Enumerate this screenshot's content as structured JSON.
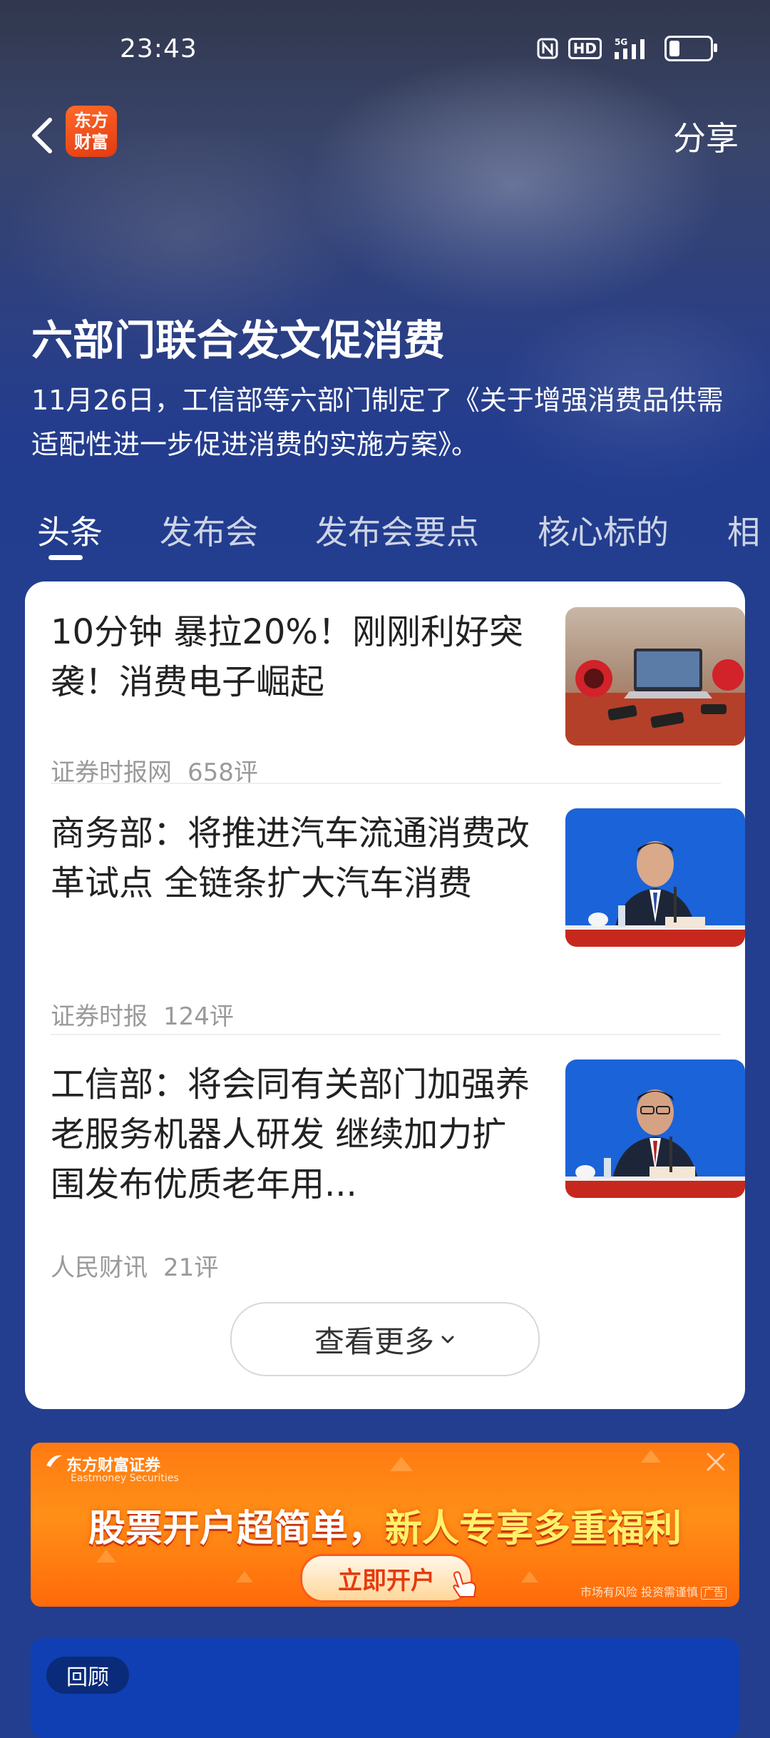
{
  "status_bar": {
    "time": "23:43",
    "icons": [
      "nfc-icon",
      "hd-icon",
      "5g-signal-icon",
      "battery-icon"
    ],
    "hd_label": "HD",
    "network_label": "5G"
  },
  "header": {
    "logo_line1": "东方",
    "logo_line2": "财富",
    "share_label": "分享"
  },
  "topic": {
    "title": "六部门联合发文促消费",
    "description": "11月26日，工信部等六部门制定了《关于增强消费品供需适配性进一步促进消费的实施方案》。"
  },
  "tabs": [
    {
      "label": "头条",
      "active": true
    },
    {
      "label": "发布会",
      "active": false
    },
    {
      "label": "发布会要点",
      "active": false
    },
    {
      "label": "核心标的",
      "active": false
    },
    {
      "label": "相",
      "active": false
    }
  ],
  "news": [
    {
      "title": "10分钟 暴拉20%！刚刚利好突袭！消费电子崛起",
      "source": "证券时报网",
      "comments": "658评",
      "thumb": "consumer-electronics-photo"
    },
    {
      "title": "商务部：将推进汽车流通消费改革试点 全链条扩大汽车消费",
      "source": "证券时报",
      "comments": "124评",
      "thumb": "press-conference-speaker-photo"
    },
    {
      "title": "工信部：将会同有关部门加强养老服务机器人研发 继续加力扩围发布优质老年用...",
      "source": "人民财讯",
      "comments": "21评",
      "thumb": "press-conference-speaker-photo"
    }
  ],
  "more_button": "查看更多",
  "ad": {
    "brand": "东方财富证券",
    "brand_en": "Eastmoney Securities",
    "headline_white": "股票开户超简单，",
    "headline_yellow": "新人专享多重福利",
    "cta": "立即开户",
    "risk_notice": "市场有风险 投资需谨慎",
    "ad_tag": "广告"
  },
  "review": {
    "pill": "回顾"
  },
  "colors": {
    "page_bg": "#233e8f",
    "card_bg": "#ffffff",
    "ad_orange": "#ff7a12",
    "review_blue": "#0f3fb2",
    "logo_orange": "#ff6a2a"
  }
}
